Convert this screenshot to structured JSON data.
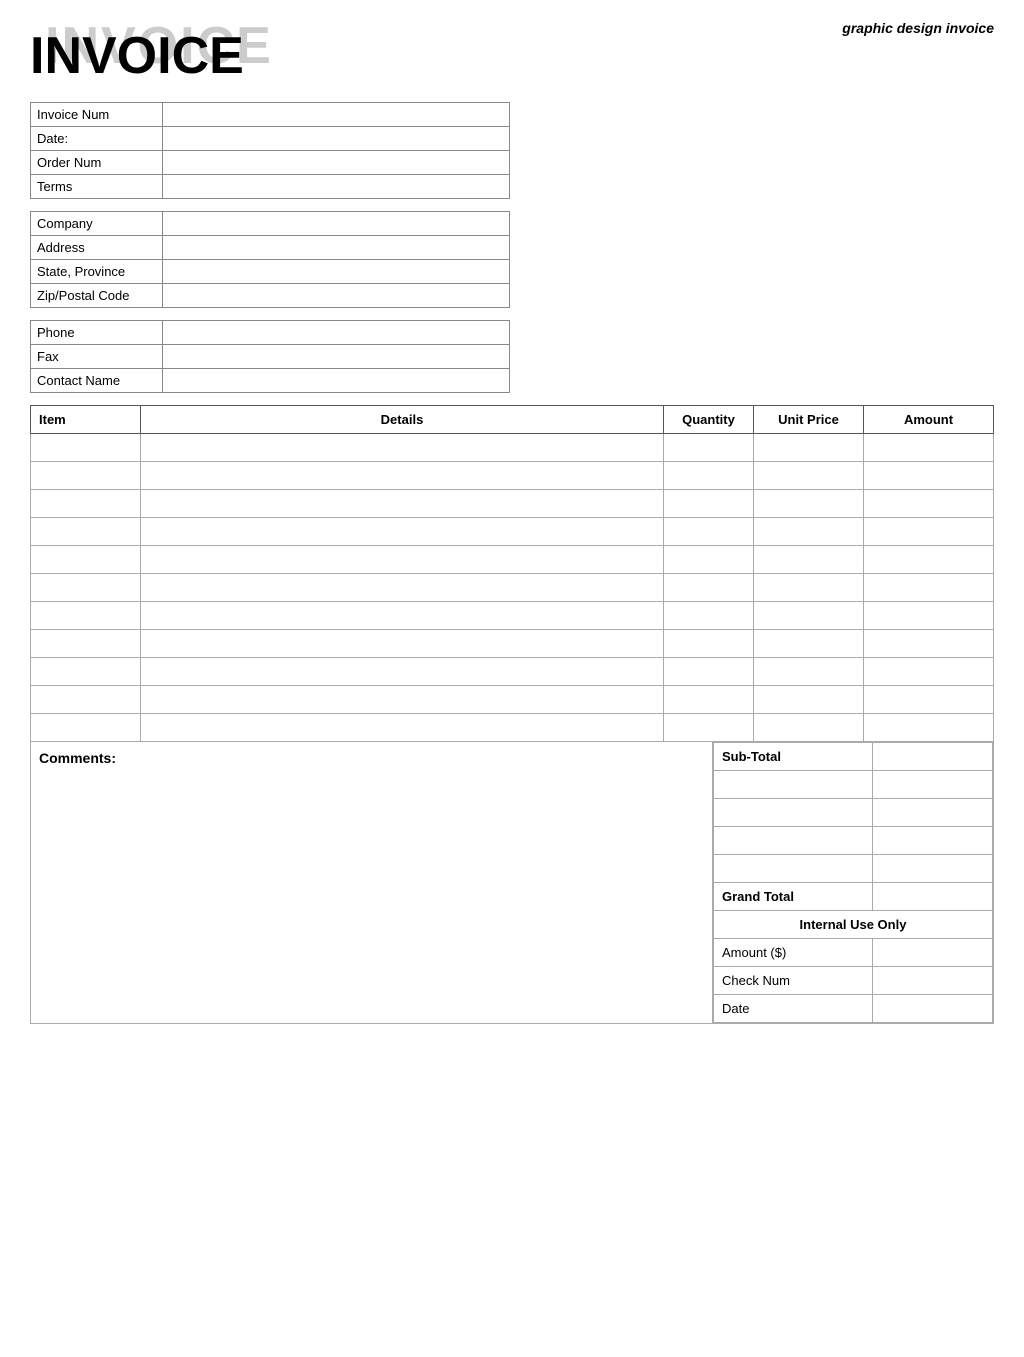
{
  "page": {
    "subtitle": "graphic design invoice",
    "watermark": "INVOICE",
    "title": "INVOICE"
  },
  "invoice_info": {
    "fields": [
      {
        "label": "Invoice Num",
        "value": ""
      },
      {
        "label": "Date:",
        "value": ""
      },
      {
        "label": "Order Num",
        "value": ""
      },
      {
        "label": "Terms",
        "value": ""
      }
    ]
  },
  "company_info": {
    "fields": [
      {
        "label": "Company",
        "value": ""
      },
      {
        "label": "Address",
        "value": ""
      },
      {
        "label": "State, Province",
        "value": ""
      },
      {
        "label": "Zip/Postal Code",
        "value": ""
      }
    ]
  },
  "contact_info": {
    "fields": [
      {
        "label": "Phone",
        "value": ""
      },
      {
        "label": "Fax",
        "value": ""
      },
      {
        "label": "Contact Name",
        "value": ""
      }
    ]
  },
  "items_table": {
    "headers": [
      "Item",
      "Details",
      "Quantity",
      "Unit Price",
      "Amount"
    ],
    "rows": [
      {
        "item": "",
        "details": "",
        "quantity": "",
        "unit_price": "",
        "amount": ""
      },
      {
        "item": "",
        "details": "",
        "quantity": "",
        "unit_price": "",
        "amount": ""
      },
      {
        "item": "",
        "details": "",
        "quantity": "",
        "unit_price": "",
        "amount": ""
      },
      {
        "item": "",
        "details": "",
        "quantity": "",
        "unit_price": "",
        "amount": ""
      },
      {
        "item": "",
        "details": "",
        "quantity": "",
        "unit_price": "",
        "amount": ""
      },
      {
        "item": "",
        "details": "",
        "quantity": "",
        "unit_price": "",
        "amount": ""
      },
      {
        "item": "",
        "details": "",
        "quantity": "",
        "unit_price": "",
        "amount": ""
      },
      {
        "item": "",
        "details": "",
        "quantity": "",
        "unit_price": "",
        "amount": ""
      },
      {
        "item": "",
        "details": "",
        "quantity": "",
        "unit_price": "",
        "amount": ""
      },
      {
        "item": "",
        "details": "",
        "quantity": "",
        "unit_price": "",
        "amount": ""
      },
      {
        "item": "",
        "details": "",
        "quantity": "",
        "unit_price": "",
        "amount": ""
      }
    ]
  },
  "comments": {
    "label": "Comments:"
  },
  "totals": {
    "subtotal_label": "Sub-Total",
    "subtotal_value": "",
    "extra_rows": [
      "",
      "",
      "",
      ""
    ],
    "grand_total_label": "Grand Total",
    "grand_total_value": "",
    "internal_use_label": "Internal Use Only",
    "internal_fields": [
      {
        "label": "Amount ($)",
        "value": ""
      },
      {
        "label": "Check Num",
        "value": ""
      },
      {
        "label": "Date",
        "value": ""
      }
    ]
  }
}
